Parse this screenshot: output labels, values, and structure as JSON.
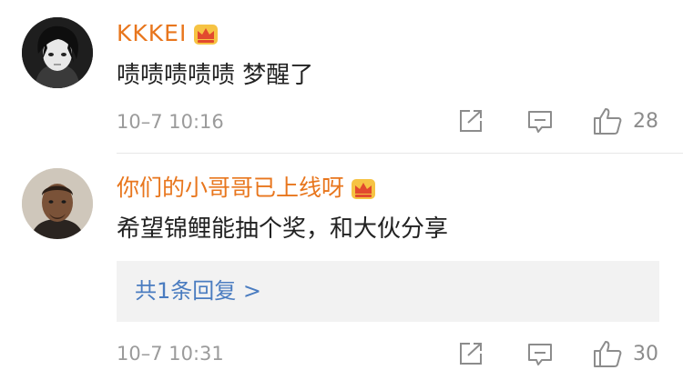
{
  "comments": [
    {
      "username": "KKKEI",
      "text": "啧啧啧啧啧 梦醒了",
      "time": "10–7 10:16",
      "likes": "28",
      "avatar_icon": "anime-avatar-icon",
      "badge_icon": "crown-badge-icon"
    },
    {
      "username": "你们的小哥哥已上线呀",
      "text": "希望锦鲤能抽个奖，和大伙分享",
      "reply_link": "共1条回复 >",
      "time": "10–7 10:31",
      "likes": "30",
      "avatar_icon": "basketball-player-avatar-icon",
      "badge_icon": "crown-badge-icon"
    }
  ],
  "colors": {
    "username": "#e8761d",
    "text": "#222222",
    "meta": "#9b9b9b",
    "link": "#4a7cc0",
    "reply_bg": "#f2f2f2"
  }
}
